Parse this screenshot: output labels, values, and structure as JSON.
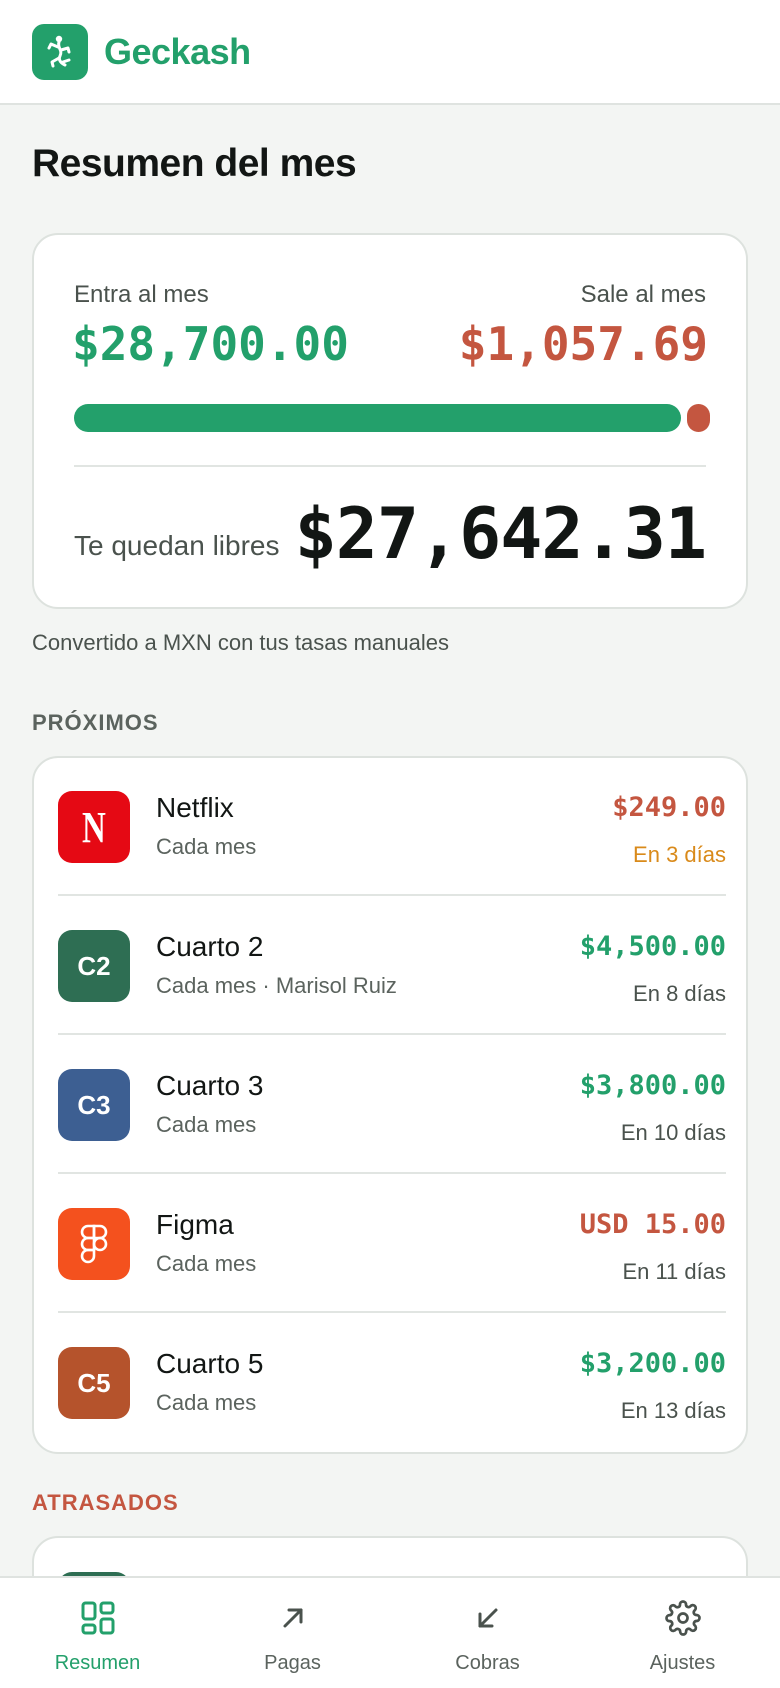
{
  "app": {
    "name": "Geckash"
  },
  "page": {
    "title": "Resumen del mes"
  },
  "summary": {
    "income_label": "Entra al mes",
    "income_amount": "$28,700.00",
    "expense_label": "Sale al mes",
    "expense_amount": "$1,057.69",
    "income_share": 0.964,
    "free_label": "Te quedan libres",
    "free_amount": "$27,642.31",
    "note": "Convertido a MXN con tus tasas manuales"
  },
  "upcoming": {
    "section_label": "PRÓXIMOS",
    "items": [
      {
        "icon": "netflix-logo",
        "icon_text": "N",
        "icon_bg": "#e50914",
        "name": "Netflix",
        "sub": "Cada mes",
        "amount": "$249.00",
        "amount_color": "#c45640",
        "when": "En 3 días",
        "when_color": "#d98a1a"
      },
      {
        "icon": "initials-badge",
        "icon_text": "C2",
        "icon_bg": "#2e6e53",
        "name": "Cuarto 2",
        "sub": "Cada mes · Marisol Ruiz",
        "amount": "$4,500.00",
        "amount_color": "#23a06b",
        "when": "En 8 días",
        "when_color": "#4a524d"
      },
      {
        "icon": "initials-badge",
        "icon_text": "C3",
        "icon_bg": "#3d5f92",
        "name": "Cuarto 3",
        "sub": "Cada mes",
        "amount": "$3,800.00",
        "amount_color": "#23a06b",
        "when": "En 10 días",
        "when_color": "#4a524d"
      },
      {
        "icon": "figma-logo",
        "icon_text": "",
        "icon_bg": "#f4511e",
        "name": "Figma",
        "sub": "Cada mes",
        "amount": "USD 15.00",
        "amount_color": "#c45640",
        "when": "En 11 días",
        "when_color": "#4a524d"
      },
      {
        "icon": "initials-badge",
        "icon_text": "C5",
        "icon_bg": "#b5532c",
        "name": "Cuarto 5",
        "sub": "Cada mes",
        "amount": "$3,200.00",
        "amount_color": "#23a06b",
        "when": "En 13 días",
        "when_color": "#4a524d"
      }
    ]
  },
  "overdue": {
    "section_label": "ATRASADOS"
  },
  "nav": {
    "items": [
      {
        "label": "Resumen",
        "icon": "grid-icon",
        "active": true
      },
      {
        "label": "Pagas",
        "icon": "arrow-up-right-icon",
        "active": false
      },
      {
        "label": "Cobras",
        "icon": "arrow-down-left-icon",
        "active": false
      },
      {
        "label": "Ajustes",
        "icon": "gear-icon",
        "active": false
      }
    ]
  },
  "colors": {
    "accent": "#23a06b",
    "expense": "#c45640",
    "warning": "#d98a1a"
  }
}
